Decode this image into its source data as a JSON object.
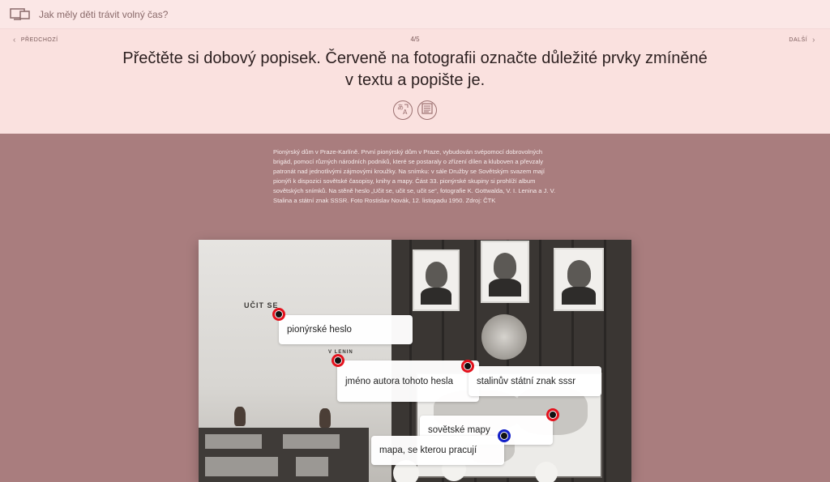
{
  "topbar": {
    "title": "Jak měly děti trávit volný čas?",
    "icon": "screens-icon"
  },
  "header": {
    "prev_label": "PŘEDCHOZÍ",
    "next_label": "DALŠÍ",
    "counter": "4/5",
    "question": "Přečtěte si dobový popisek. Červeně na fotografii označte důležité prvky zmíněné v textu a popište je.",
    "tools": [
      "translate-icon",
      "text-document-icon"
    ]
  },
  "description": "Pionýrský dům v Praze-Karlíně. První pionýrský dům v Praze, vybudován svépomocí dobrovolných brigád, pomocí různých národních podniků, které se postaraly o zřízení dílen a kluboven a převzaly patronát nad jednotlivými zájmovými kroužky. Na snímku: v sále Družby se Sovětským svazem mají pionýři k dispozici sovětské časopisy, knihy a mapy. Část 33. pionýrské skupiny si prohlíží album sovětských snímků. Na stěně heslo „Učit se, učit se, učit se“, fotografie K. Gottwalda, V. I. Lenina a J. V. Stalina a státní znak SSSR. Foto Rostislav Novák, 12. listopadu 1950. Zdroj: ČTK",
  "photo": {
    "wall_text_1": "UČIT SE",
    "wall_text_2": "V LENIN"
  },
  "annotations": [
    {
      "text": "pionýrské heslo",
      "color": "red"
    },
    {
      "text": "jméno autora tohoto hesla",
      "color": "red"
    },
    {
      "text": "stalinův státní znak sssr",
      "color": "red"
    },
    {
      "text": "sovětské mapy",
      "color": "red"
    },
    {
      "text": "mapa, se kterou pracují",
      "color": "blue"
    }
  ],
  "colors": {
    "accent_red": "#e3121d",
    "accent_blue": "#1421c8",
    "header_bg": "#fae1df",
    "content_bg": "#a97d7e"
  }
}
